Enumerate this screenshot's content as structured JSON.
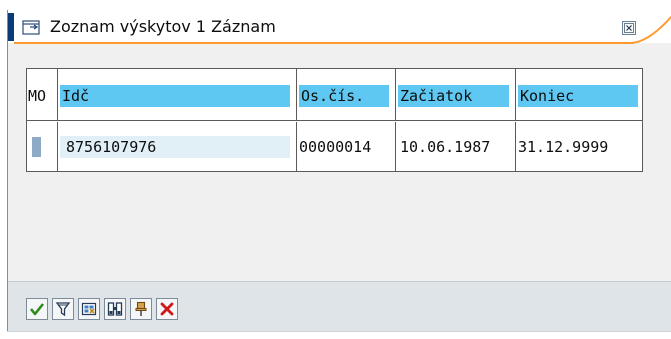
{
  "window": {
    "title": "Zoznam výskytov 1 Záznam"
  },
  "table": {
    "columns": [
      "MO",
      "Idč",
      "Os.čís.",
      "Začiatok",
      "Koniec"
    ],
    "rows": [
      {
        "mo": "",
        "idc": "8756107976",
        "os_cis": "00000014",
        "zaciatok": "10.06.1987",
        "koniec": "31.12.9999"
      }
    ]
  },
  "toolbar": {
    "buttons": [
      "check-icon",
      "filter-icon",
      "select-all-icon",
      "find-icon",
      "pin-icon",
      "cancel-icon"
    ]
  },
  "colors": {
    "header_highlight": "#5ec8f3",
    "title_accent": "#0a3a78",
    "title_sweep": "#ff9b2e",
    "check_green": "#2e8b1e",
    "cancel_red": "#d01818"
  }
}
